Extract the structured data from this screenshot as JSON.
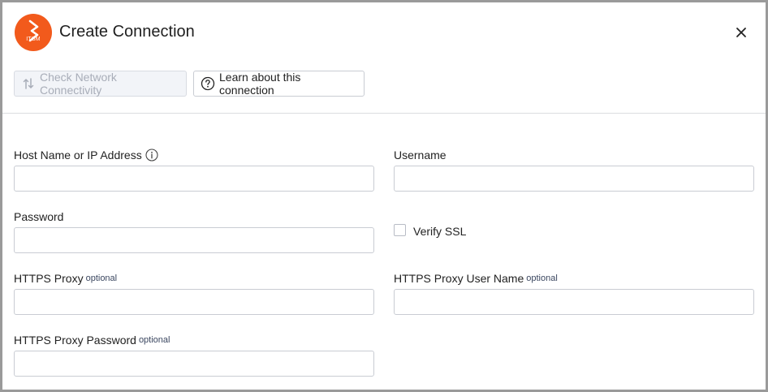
{
  "dialog": {
    "title": "Create Connection",
    "logo_text": "ITSM"
  },
  "toolbar": {
    "check_label": "Check Network Connectivity",
    "learn_label": "Learn about this connection"
  },
  "form": {
    "host": {
      "label": "Host Name or IP Address",
      "value": "",
      "placeholder": ""
    },
    "username": {
      "label": "Username",
      "value": "",
      "placeholder": ""
    },
    "password": {
      "label": "Password",
      "value": "",
      "placeholder": ""
    },
    "verify_ssl": {
      "label": "Verify SSL",
      "checked": false
    },
    "https_proxy": {
      "label": "HTTPS Proxy",
      "optional": "optional",
      "value": "",
      "placeholder": ""
    },
    "https_proxy_user": {
      "label": "HTTPS Proxy User Name",
      "optional": "optional",
      "value": "",
      "placeholder": ""
    },
    "https_proxy_password": {
      "label": "HTTPS Proxy Password",
      "optional": "optional",
      "value": "",
      "placeholder": ""
    }
  },
  "colors": {
    "brand": "#f25a1c",
    "disabled_text": "#a8adb8",
    "border": "#c9ccd3"
  },
  "icons": {
    "logo": "itsm-logo-icon",
    "close": "close-icon",
    "check": "network-arrows-icon",
    "learn": "question-circle-icon",
    "info": "info-circle-icon"
  }
}
